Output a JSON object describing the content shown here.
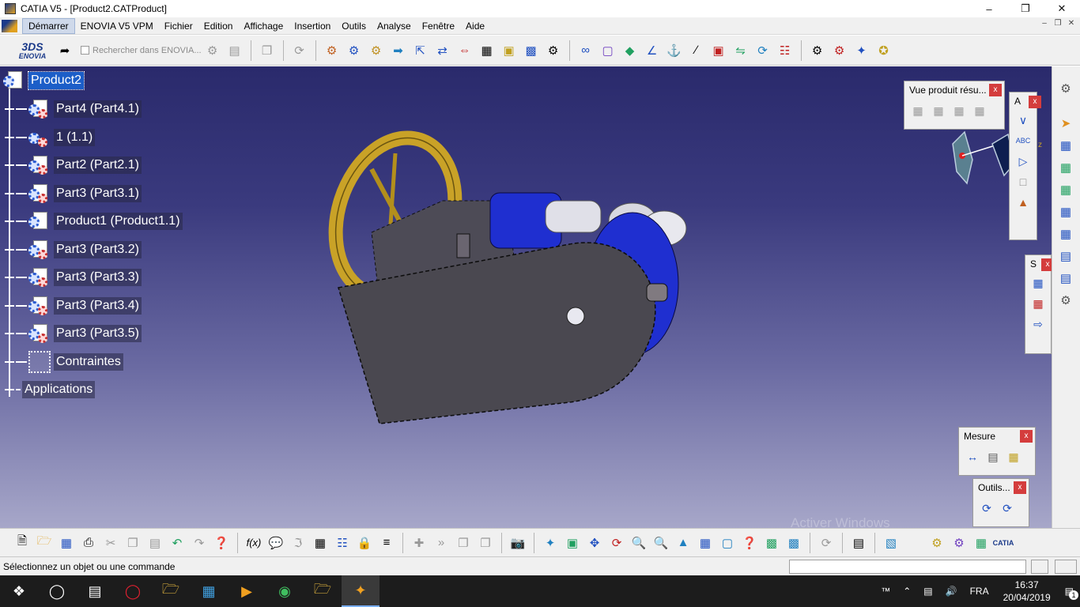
{
  "window": {
    "title": "CATIA V5 - [Product2.CATProduct]"
  },
  "menu": {
    "items": [
      "Démarrer",
      "ENOVIA V5 VPM",
      "Fichier",
      "Edition",
      "Affichage",
      "Insertion",
      "Outils",
      "Analyse",
      "Fenêtre",
      "Aide"
    ],
    "active_index": 0
  },
  "top_toolbar": {
    "logo_text": "ENOVIA",
    "search_placeholder": "Rechercher dans ENOVIA..."
  },
  "tree": {
    "root": "Product2",
    "nodes": [
      "Part4 (Part4.1)",
      "1 (1.1)",
      "Part2 (Part2.1)",
      "Part3 (Part3.1)",
      "Product1 (Product1.1)",
      "Part3 (Part3.2)",
      "Part3 (Part3.3)",
      "Part3 (Part3.4)",
      "Part3 (Part3.5)",
      "Contraintes"
    ],
    "applications": "Applications"
  },
  "panels": {
    "vue_produit": {
      "title": "Vue produit résu...",
      "close": "x"
    },
    "a_panel": {
      "title": "A",
      "close": "x"
    },
    "s_panel": {
      "title": "S",
      "close": "x"
    },
    "mesure": {
      "title": "Mesure",
      "close": "x"
    },
    "outils": {
      "title": "Outils...",
      "close": "x"
    }
  },
  "compass": {
    "axis_label": "z"
  },
  "status": {
    "message": "Sélectionnez un objet ou une commande"
  },
  "watermark": "Activer Windows",
  "taskbar": {
    "language": "FRA",
    "time": "16:37",
    "date": "20/04/2019",
    "notification_count": "1"
  },
  "colors": {
    "viewport_top": "#2a2a6c",
    "viewport_bottom": "#a7a7c9",
    "selection": "#1c5ec8",
    "part_gold": "#c9a227",
    "part_blue": "#1f2fd0",
    "part_gray": "#4a4850"
  }
}
